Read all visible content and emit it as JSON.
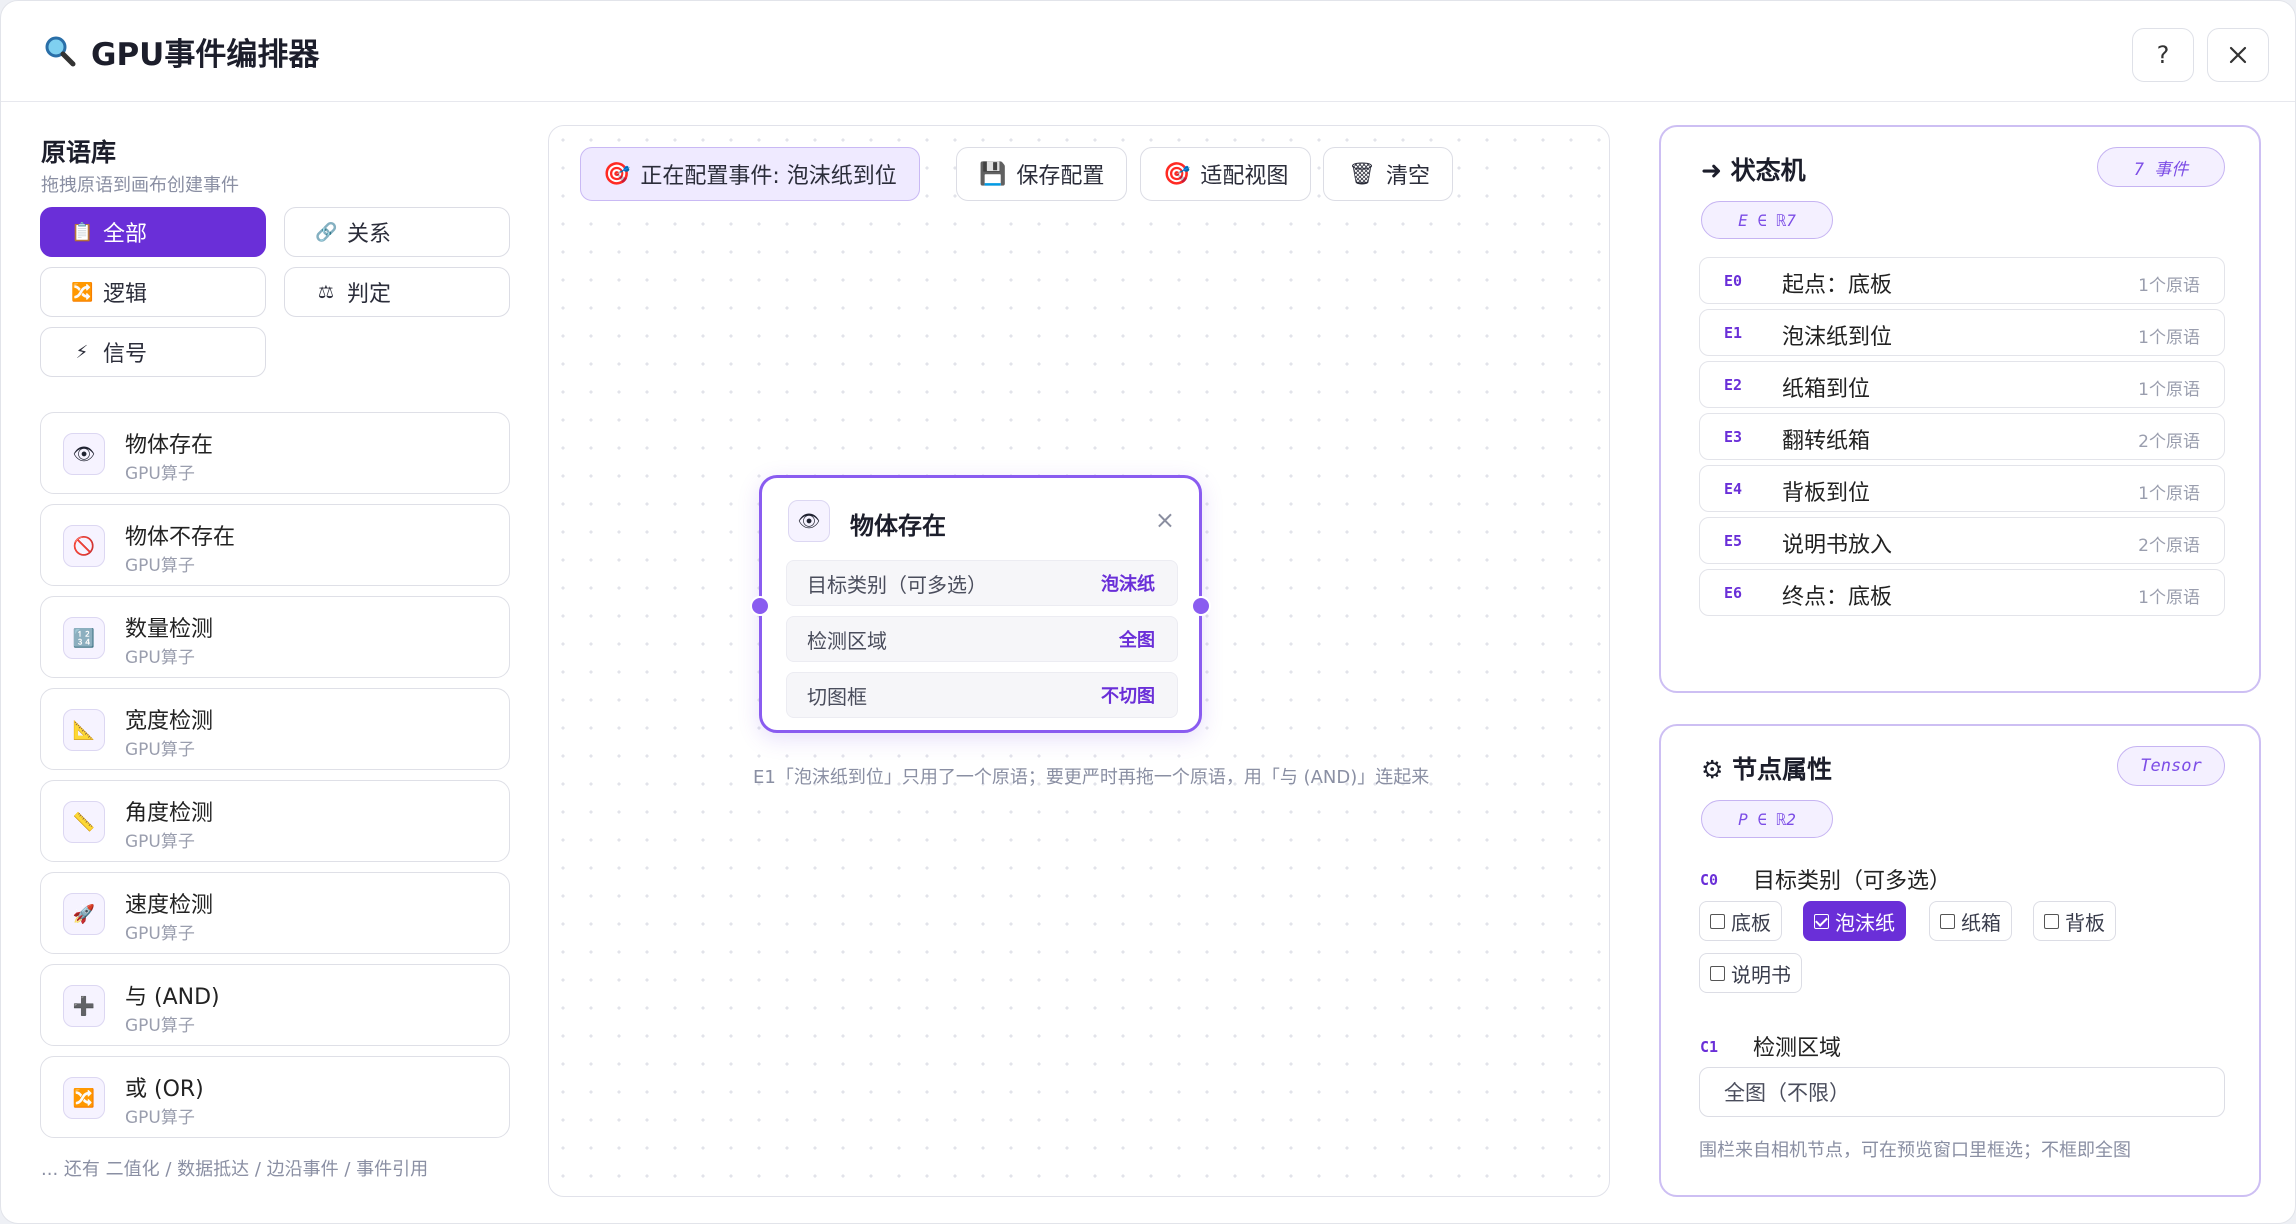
{
  "app": {
    "title": "GPU事件编排器",
    "help_label": "?",
    "close_label": "✕"
  },
  "library": {
    "title": "原语库",
    "subtitle": "拖拽原语到画布创建事件",
    "filters": [
      {
        "label": "全部",
        "icon": "📋"
      },
      {
        "label": "关系",
        "icon": "🔗"
      },
      {
        "label": "逻辑",
        "icon": "🔀"
      },
      {
        "label": "判定",
        "icon": "⚖"
      },
      {
        "label": "信号",
        "icon": "⚡"
      }
    ],
    "primitives": [
      {
        "name": "物体存在",
        "type": "GPU算子",
        "icon": "👁"
      },
      {
        "name": "物体不存在",
        "type": "GPU算子",
        "icon": "🚫"
      },
      {
        "name": "数量检测",
        "type": "GPU算子",
        "icon": "🔢"
      },
      {
        "name": "宽度检测",
        "type": "GPU算子",
        "icon": "📐"
      },
      {
        "name": "角度检测",
        "type": "GPU算子",
        "icon": "📏"
      },
      {
        "name": "速度检测",
        "type": "GPU算子",
        "icon": "🚀"
      },
      {
        "name": "与 (AND)",
        "type": "GPU算子",
        "icon": "➕"
      },
      {
        "name": "或 (OR)",
        "type": "GPU算子",
        "icon": "🔀"
      }
    ],
    "footer": "... 还有 二值化 / 数据抵达 / 边沿事件 / 事件引用"
  },
  "toolbar": {
    "configuring": "正在配置事件: 泡沫纸到位",
    "save": "保存配置",
    "fit": "适配视图",
    "clear": "清空"
  },
  "node": {
    "title": "物体存在",
    "close": "×",
    "rows": [
      {
        "key": "目标类别（可多选）",
        "value": "泡沫纸"
      },
      {
        "key": "检测区域",
        "value": "全图"
      },
      {
        "key": "切图框",
        "value": "不切图"
      }
    ]
  },
  "canvas_hint": "E1「泡沫纸到位」只用了一个原语；要更严时再拖一个原语，用「与 (AND)」连起来",
  "state_machine": {
    "title": "➜ 状态机",
    "count_badge": "7 事件",
    "formula": "E ∈ ℝ7",
    "events": [
      {
        "id": "E0",
        "name": "起点：底板",
        "count": "1个原语"
      },
      {
        "id": "E1",
        "name": "泡沫纸到位",
        "count": "1个原语"
      },
      {
        "id": "E2",
        "name": "纸箱到位",
        "count": "1个原语"
      },
      {
        "id": "E3",
        "name": "翻转纸箱",
        "count": "2个原语"
      },
      {
        "id": "E4",
        "name": "背板到位",
        "count": "1个原语"
      },
      {
        "id": "E5",
        "name": "说明书放入",
        "count": "2个原语"
      },
      {
        "id": "E6",
        "name": "终点：底板",
        "count": "1个原语"
      }
    ]
  },
  "properties": {
    "title": "⚙ 节点属性",
    "badge": "Tensor",
    "formula": "P ∈ ℝ2",
    "c0": {
      "id": "C0",
      "label": "目标类别（可多选）",
      "options": [
        {
          "label": "底板",
          "checked": false
        },
        {
          "label": "泡沫纸",
          "checked": true
        },
        {
          "label": "纸箱",
          "checked": false
        },
        {
          "label": "背板",
          "checked": false
        },
        {
          "label": "说明书",
          "checked": false
        }
      ]
    },
    "c1": {
      "id": "C1",
      "label": "检测区域",
      "value": "全图（不限）"
    },
    "note": "围栏来自相机节点，可在预览窗口里框选；不框即全图"
  }
}
